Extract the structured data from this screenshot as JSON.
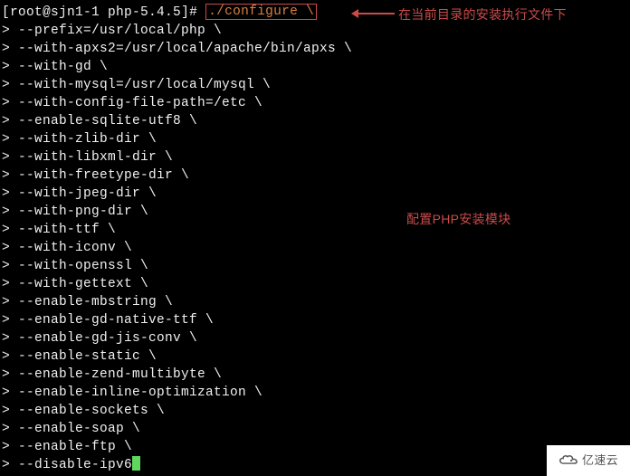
{
  "prompt": {
    "user_host": "root@sjn1-1",
    "cwd": "php-5.4.5",
    "symbol": "#"
  },
  "command": "./configure \\",
  "annotations": {
    "top": "在当前目录的安装执行文件下",
    "mid": "配置PHP安装模块"
  },
  "lines": {
    "l0": "> --prefix=/usr/local/php \\",
    "l1": "> --with-apxs2=/usr/local/apache/bin/apxs \\",
    "l2": "> --with-gd \\",
    "l3": "> --with-mysql=/usr/local/mysql \\",
    "l4": "> --with-config-file-path=/etc \\",
    "l5": "> --enable-sqlite-utf8 \\",
    "l6": "> --with-zlib-dir \\",
    "l7": "> --with-libxml-dir \\",
    "l8": "> --with-freetype-dir \\",
    "l9": "> --with-jpeg-dir \\",
    "l10": "> --with-png-dir \\",
    "l11": "> --with-ttf \\",
    "l12": "> --with-iconv \\",
    "l13": "> --with-openssl \\",
    "l14": "> --with-gettext \\",
    "l15": "> --enable-mbstring \\",
    "l16": "> --enable-gd-native-ttf \\",
    "l17": "> --enable-gd-jis-conv \\",
    "l18": "> --enable-static \\",
    "l19": "> --enable-zend-multibyte \\",
    "l20": "> --enable-inline-optimization \\",
    "l21": "> --enable-sockets \\",
    "l22": "> --enable-soap \\",
    "l23": "> --enable-ftp \\",
    "l24": "> --disable-ipv6"
  },
  "watermark": "亿速云"
}
